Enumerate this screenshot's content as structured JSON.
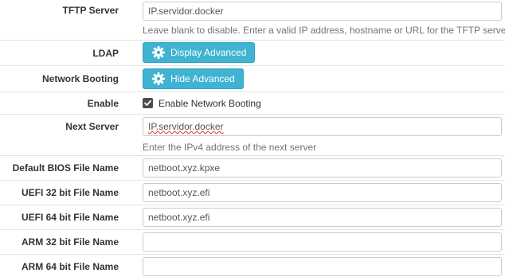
{
  "tftp": {
    "label": "TFTP Server",
    "value": "IP.servidor.docker",
    "help": "Leave blank to disable. Enter a valid IP address, hostname or URL for the TFTP server."
  },
  "ldap": {
    "label": "LDAP",
    "button_label": "Display Advanced",
    "button_icon": "gear-icon"
  },
  "network_booting": {
    "label": "Network Booting",
    "button_label": "Hide Advanced",
    "button_icon": "gear-icon"
  },
  "enable": {
    "label": "Enable",
    "checkbox_label": "Enable Network Booting",
    "checked": true
  },
  "next_server": {
    "label": "Next Server",
    "value": "IP.servidor.docker",
    "help": "Enter the IPv4 address of the next server"
  },
  "bios_file": {
    "label": "Default BIOS File Name",
    "value": "netboot.xyz.kpxe"
  },
  "uefi32_file": {
    "label": "UEFI 32 bit File Name",
    "value": "netboot.xyz.efi"
  },
  "uefi64_file": {
    "label": "UEFI 64 bit File Name",
    "value": "netboot.xyz.efi"
  },
  "arm32_file": {
    "label": "ARM 32 bit File Name",
    "value": ""
  },
  "arm64_file": {
    "label": "ARM 64 bit File Name",
    "value": ""
  },
  "colors": {
    "button_bg": "#3fb3d1",
    "checkbox_bg": "#4d4d4d",
    "spellcheck": "#e03030"
  }
}
